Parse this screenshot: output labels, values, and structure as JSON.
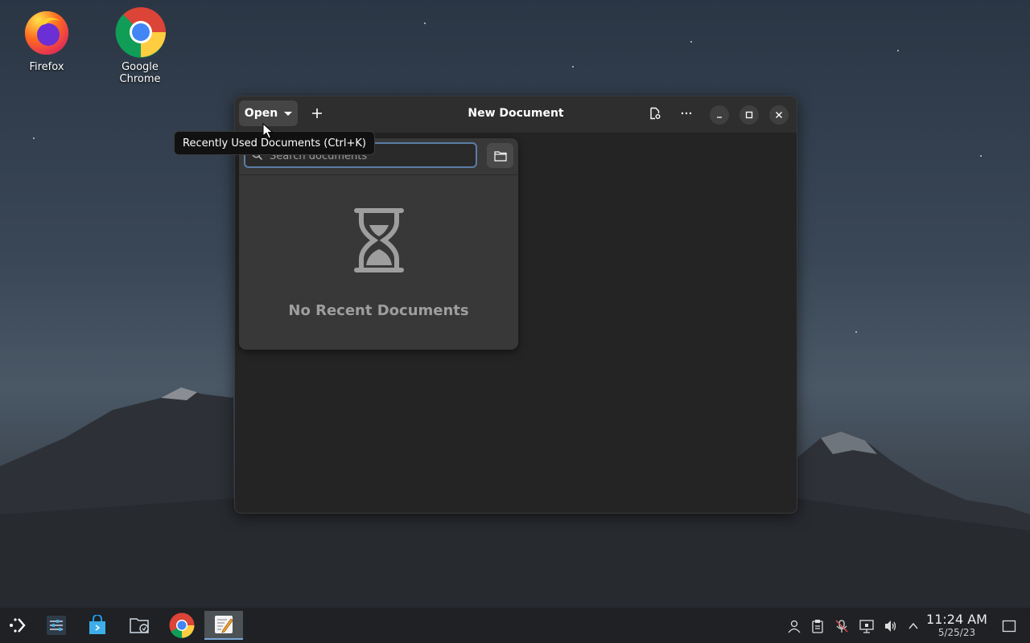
{
  "desktop": {
    "icons": [
      {
        "label": "Firefox",
        "icon": "firefox-icon"
      },
      {
        "label": "Google Chrome",
        "icon": "chrome-icon"
      }
    ]
  },
  "window": {
    "title": "New Document",
    "open_label": "Open",
    "tooltip": "Recently Used Documents (Ctrl+K)",
    "search_placeholder": "Search documents",
    "empty_state": "No Recent Documents"
  },
  "taskbar": {
    "time": "11:24 AM",
    "date": "5/25/23"
  }
}
